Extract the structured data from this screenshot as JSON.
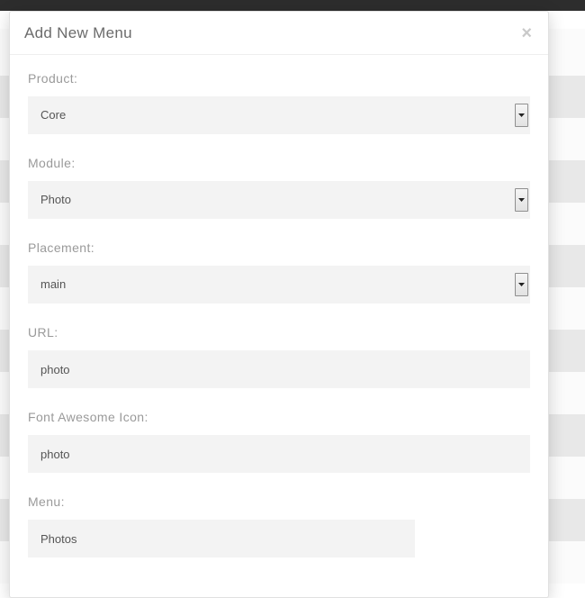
{
  "modal": {
    "title": "Add New Menu",
    "fields": {
      "product": {
        "label": "Product:",
        "value": "Core"
      },
      "module": {
        "label": "Module:",
        "value": "Photo"
      },
      "placement": {
        "label": "Placement:",
        "value": "main"
      },
      "url": {
        "label": "URL:",
        "value": "photo"
      },
      "icon": {
        "label": "Font Awesome Icon:",
        "value": "photo"
      },
      "menu": {
        "label": "Menu:",
        "value": "Photos"
      }
    }
  }
}
